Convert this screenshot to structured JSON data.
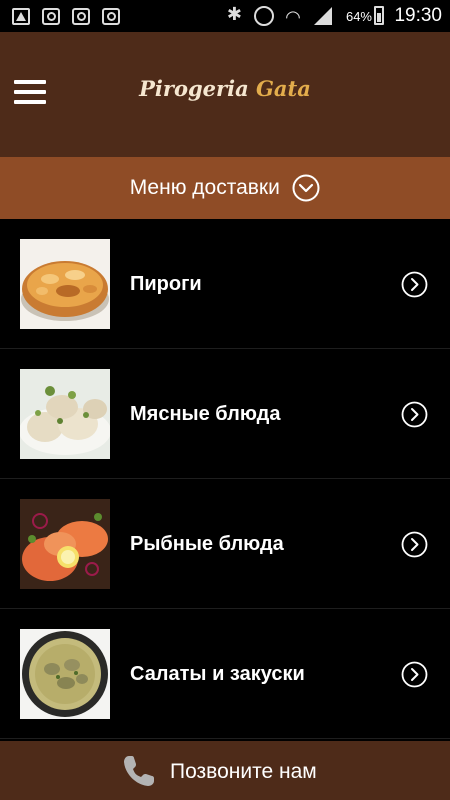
{
  "status_bar": {
    "battery": "64%",
    "time": "19:30"
  },
  "header": {
    "logo_part1": "Pirogeria",
    "logo_part2": "Gata"
  },
  "delivery_bar": {
    "label": "Меню доставки"
  },
  "categories": [
    {
      "label": "Пироги",
      "image": "pie-photo"
    },
    {
      "label": "Мясные блюда",
      "image": "dumplings-photo"
    },
    {
      "label": "Рыбные блюда",
      "image": "fish-photo"
    },
    {
      "label": "Салаты и закуски",
      "image": "soup-photo"
    }
  ],
  "footer": {
    "label": "Позвоните нам"
  },
  "colors": {
    "header_bg": "#4e2b19",
    "delivery_bar_bg": "#8f4c26",
    "logo_accent": "#e3ad4c"
  }
}
